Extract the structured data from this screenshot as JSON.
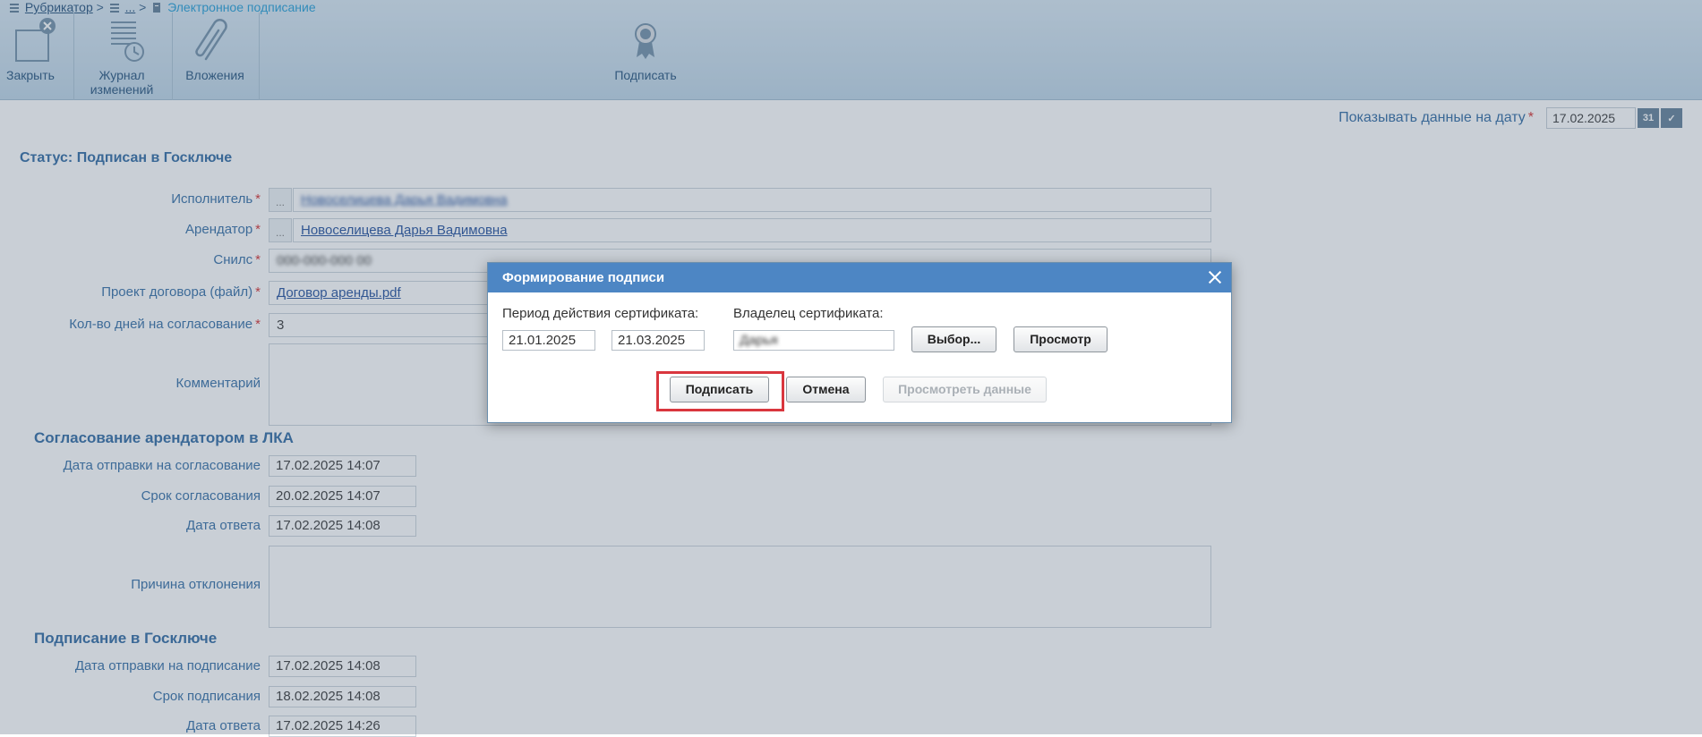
{
  "breadcrumb": {
    "rubricator": "Рубрикатор",
    "sep": ">",
    "ellipsis": "...",
    "current": "Электронное подписание"
  },
  "toolbar": {
    "close": "Закрыть",
    "journal_line1": "Журнал",
    "journal_line2": "изменений",
    "attachments": "Вложения",
    "sign": "Подписать"
  },
  "header": {
    "show_date_label": "Показывать данные на дату",
    "show_date_value": "17.02.2025",
    "calendar_btn": "31"
  },
  "status": "Статус: Подписан в Госключе",
  "form": {
    "executor_label": "Исполнитель",
    "executor_value": "Новоселицева Дарья Вадимовна",
    "tenant_label": "Арендатор",
    "tenant_value": "Новоселицева Дарья Вадимовна",
    "snils_label": "Снилс",
    "snils_value": "000-000-000 00",
    "project_label": "Проект договора (файл)",
    "project_value": "Договор аренды.pdf",
    "days_label": "Кол-во дней на согласование",
    "days_value": "3",
    "comment_label": "Комментарий"
  },
  "section1": {
    "title": "Согласование арендатором в ЛКА",
    "sent_label": "Дата отправки на согласование",
    "sent_value": "17.02.2025 14:07",
    "deadline_label": "Срок согласования",
    "deadline_value": "20.02.2025 14:07",
    "answer_label": "Дата ответа",
    "answer_value": "17.02.2025 14:08",
    "reject_label": "Причина отклонения"
  },
  "section2": {
    "title": "Подписание в Госключе",
    "sent_label": "Дата отправки на подписание",
    "sent_value": "17.02.2025 14:08",
    "deadline_label": "Срок подписания",
    "deadline_value": "18.02.2025 14:08",
    "answer_label": "Дата ответа",
    "answer_value": "17.02.2025 14:26"
  },
  "dialog": {
    "title": "Формирование подписи",
    "period_label": "Период действия сертификата:",
    "date_from": "21.01.2025",
    "date_to": "21.03.2025",
    "owner_label": "Владелец сертификата:",
    "owner_value": "Дарья",
    "choose_btn": "Выбор...",
    "view_btn": "Просмотр",
    "sign_btn": "Подписать",
    "cancel_btn": "Отмена",
    "view_data_btn": "Просмотреть данные"
  }
}
